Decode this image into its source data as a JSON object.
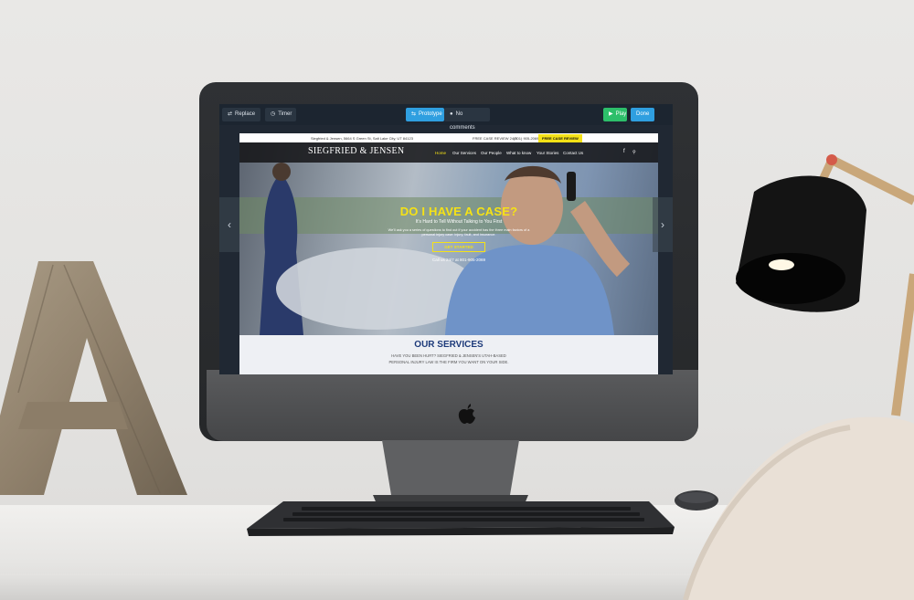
{
  "editor": {
    "replace_label": "Replace",
    "timer_label": "Timer",
    "prototype_label": "Prototype",
    "comments_label": "No comments",
    "play_label": "Play",
    "done_label": "Done",
    "colors": {
      "prototype": "#2f9fe0",
      "play": "#2dbf6a",
      "done": "#2f9fe0"
    }
  },
  "site": {
    "address": "Siegfried & Jensen, 5664 S Green St, Salt Lake City, UT 84123",
    "phone_label": "FREE CASE REVIEW 24/7",
    "phone": "(801) 905-2069",
    "cta_top": "FREE CASE REVIEW",
    "logo": "SIEGFRIED & JENSEN",
    "nav": [
      "Home",
      "Our Services",
      "Our People",
      "What to know",
      "Your Stories",
      "Contact Us"
    ],
    "hero_title": "DO I HAVE A CASE?",
    "hero_subtitle": "It's Hard to Tell Without Talking to You First",
    "hero_body": "We'll ask you a series of questions to find out if your accident has the three main factors of a personal injury case: injury, fault, and insurance.",
    "hero_button": "GET STARTED",
    "hero_call": "Call us 24/7 at 801-905-2069",
    "services_title": "OUR SERVICES",
    "services_line1": "HAVE YOU BEEN HURT? SIEGFRIED & JENSEN'S UTAH-BASED",
    "services_line2": "PERSONAL INJURY LAW IS THE FIRM YOU WANT ON YOUR SIDE.",
    "colors": {
      "accent_yellow": "#f5e216",
      "navy": "#1d3a7a"
    }
  }
}
